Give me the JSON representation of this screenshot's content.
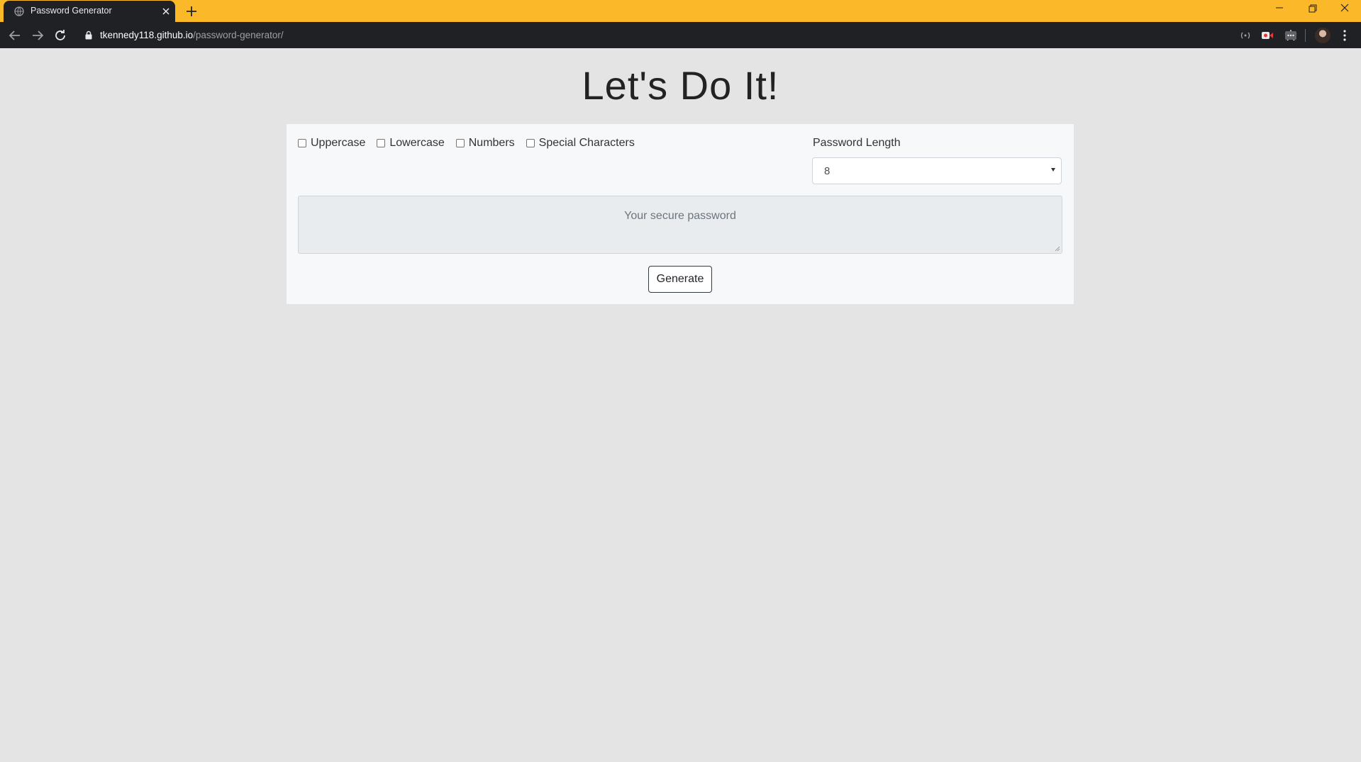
{
  "browser": {
    "tab_title": "Password Generator",
    "url_host": "tkennedy118.github.io",
    "url_path": "/password-generator/"
  },
  "page": {
    "heading": "Let's Do It!",
    "options": [
      {
        "label": "Uppercase",
        "checked": false
      },
      {
        "label": "Lowercase",
        "checked": false
      },
      {
        "label": "Numbers",
        "checked": false
      },
      {
        "label": "Special Characters",
        "checked": false
      }
    ],
    "length_label": "Password Length",
    "length_value": "8",
    "password_placeholder": "Your secure password",
    "generate_label": "Generate"
  },
  "colors": {
    "titlebar": "#fbb829",
    "chrome_dark": "#202124",
    "page_bg": "#e4e4e4",
    "card_bg": "#f7f8fa"
  }
}
